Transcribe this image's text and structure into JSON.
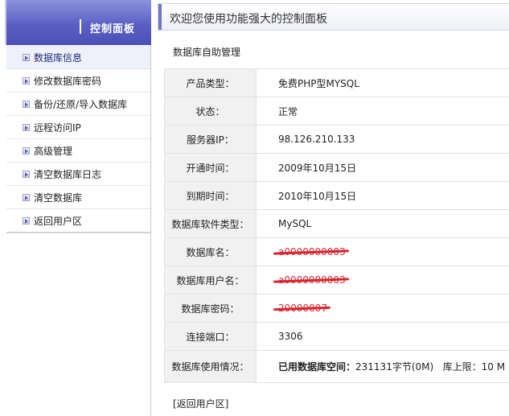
{
  "sidebar": {
    "title": "控制面板",
    "items": [
      {
        "label": "数据库信息"
      },
      {
        "label": "修改数据库密码"
      },
      {
        "label": "备份/还原/导入数据库"
      },
      {
        "label": "远程访问IP"
      },
      {
        "label": "高级管理"
      },
      {
        "label": "清空数据库日志"
      },
      {
        "label": "清空数据库"
      },
      {
        "label": "返回用户区"
      }
    ]
  },
  "header": {
    "title": "欢迎您使用功能强大的控制面板"
  },
  "section": {
    "title": "数据库自助管理"
  },
  "info": {
    "product_type_label": "产品类型：",
    "product_type_value": "免费PHP型MYSQL",
    "status_label": "状态：",
    "status_value": "正常",
    "server_ip_label": "服务器IP：",
    "server_ip_value": "98.126.210.133",
    "open_date_label": "开通时间：",
    "open_date_value": "2009年10月15日",
    "expire_date_label": "到期时间：",
    "expire_date_value": "2010年10月15日",
    "db_software_label": "数据库软件类型：",
    "db_software_value": "MySQL",
    "db_name_label": "数据库名：",
    "db_name_value": "a0000000003",
    "db_user_label": "数据库用户名：",
    "db_user_value": "a0000000003",
    "db_password_label": "数据库密码：",
    "db_password_value": "20000007",
    "port_label": "连接端口：",
    "port_value": "3306",
    "usage_label": "数据库使用情况：",
    "usage_used_label": "已用数据库空间：",
    "usage_used_value": "231131字节(0M)",
    "usage_limit_label": "库上限：",
    "usage_limit_value": "10 M"
  },
  "footer": {
    "back_link": "[返回用户区]"
  }
}
